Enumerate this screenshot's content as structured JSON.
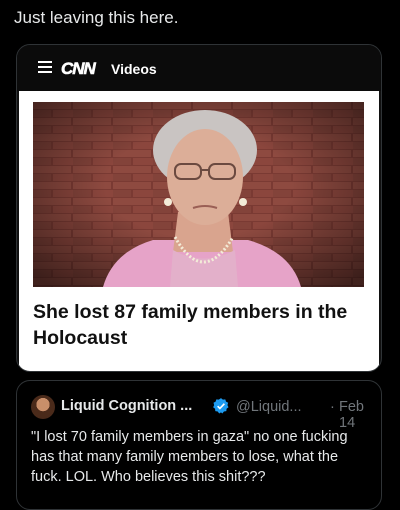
{
  "post": {
    "text": "Just leaving this here."
  },
  "embed": {
    "brand": "CNN",
    "section": "Videos",
    "headline": "She lost 87 family members in the Holocaust",
    "thumbnail_description_icon": "video-thumbnail"
  },
  "quote": {
    "display_name": "Liquid Cognition ...",
    "handle": "@Liquid...",
    "separator": "·",
    "date": "Feb 14",
    "text": "\"I lost 70 family members in gaza\"  no one fucking has that many family members to lose, what the fuck. LOL. Who believes this shit???"
  },
  "colors": {
    "background": "#000000",
    "verified_badge": "#1d9bf0",
    "muted_text": "#71767b",
    "primary_text": "#e7e9ea"
  }
}
